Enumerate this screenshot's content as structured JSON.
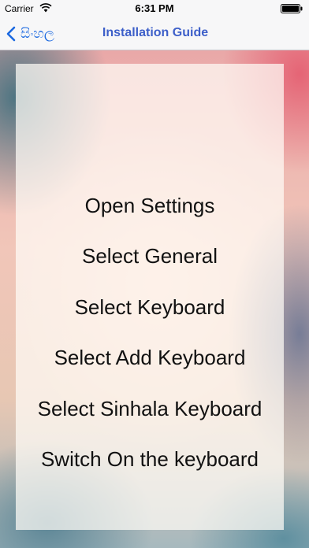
{
  "status_bar": {
    "carrier": "Carrier",
    "time": "6:31 PM",
    "wifi_icon": "wifi-icon",
    "battery_icon": "battery-icon"
  },
  "nav": {
    "back_label": "සිංහල",
    "back_icon": "chevron-left-icon",
    "title": "Installation Guide",
    "accent_color": "#1a68e0"
  },
  "steps": [
    "Open Settings",
    "Select General",
    "Select Keyboard",
    "Select Add Keyboard",
    "Select Sinhala Keyboard",
    "Switch On the keyboard"
  ]
}
